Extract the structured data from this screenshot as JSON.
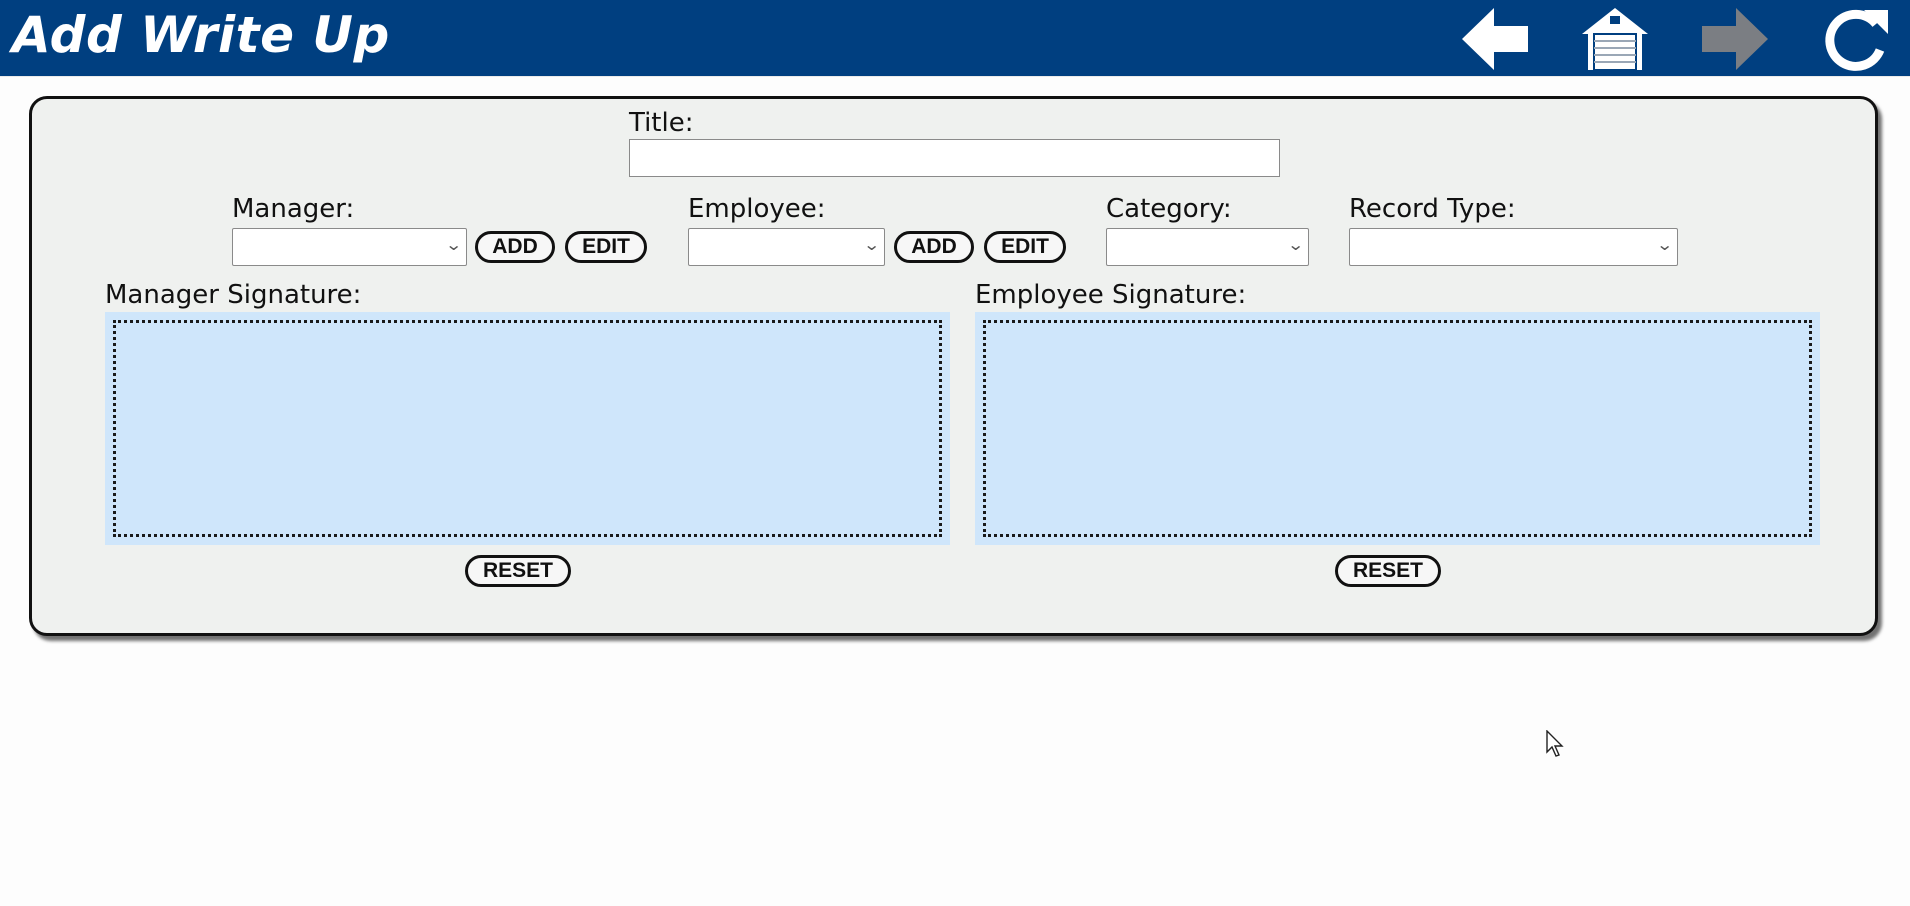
{
  "header": {
    "title": "Add Write Up",
    "background_color": "#003f80",
    "nav": [
      {
        "icon": "back-arrow-icon"
      },
      {
        "icon": "home-garage-icon"
      },
      {
        "icon": "forward-arrow-icon",
        "state": "disabled"
      },
      {
        "icon": "refresh-icon"
      }
    ]
  },
  "form": {
    "title_label": "Title:",
    "title_value": "",
    "manager": {
      "label": "Manager:",
      "selected": "",
      "add_label": "ADD",
      "edit_label": "EDIT"
    },
    "employee": {
      "label": "Employee:",
      "selected": "",
      "add_label": "ADD",
      "edit_label": "EDIT"
    },
    "category": {
      "label": "Category:",
      "selected": ""
    },
    "record_type": {
      "label": "Record Type:",
      "selected": ""
    },
    "manager_signature": {
      "label": "Manager Signature:",
      "reset_label": "RESET"
    },
    "employee_signature": {
      "label": "Employee Signature:",
      "reset_label": "RESET"
    }
  },
  "colors": {
    "panel_background": "#eff1ef",
    "signature_pad": "#cfe6fb"
  }
}
